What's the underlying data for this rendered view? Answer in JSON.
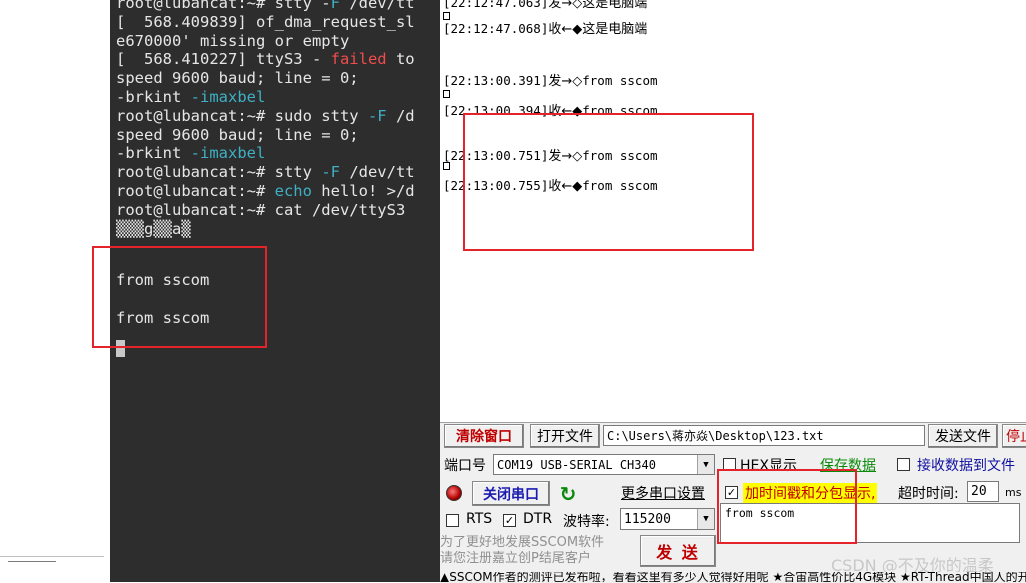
{
  "terminal": {
    "lines": [
      [
        {
          "t": "root@lubancat:~# stty -"
        },
        {
          "t": "F",
          "c": "cyan"
        },
        {
          "t": " /dev/tt"
        }
      ],
      [
        {
          "t": "[  568.409839] of_dma_request_sl"
        }
      ],
      [
        {
          "t": "e670000' missing or empty"
        }
      ],
      [
        {
          "t": "[  568.410227] ttyS3 - "
        },
        {
          "t": "failed",
          "c": "red"
        },
        {
          "t": " to"
        }
      ],
      [
        {
          "t": "speed 9600 baud; line = 0;"
        }
      ],
      [
        {
          "t": "-brkint "
        },
        {
          "t": "-imaxbel",
          "c": "cyan"
        }
      ],
      [
        {
          "t": "root@lubancat:~# sudo stty "
        },
        {
          "t": "-F",
          "c": "cyan"
        },
        {
          "t": " /d"
        }
      ],
      [
        {
          "t": "speed 9600 baud; line = 0;"
        }
      ],
      [
        {
          "t": "-brkint "
        },
        {
          "t": "-imaxbel",
          "c": "cyan"
        }
      ],
      [
        {
          "t": "root@lubancat:~# stty "
        },
        {
          "t": "-F",
          "c": "cyan"
        },
        {
          "t": " /dev/tt"
        }
      ],
      [
        {
          "t": "root@lubancat:~# "
        },
        {
          "t": "echo",
          "c": "cyan"
        },
        {
          "t": " hello! >/d"
        }
      ],
      [
        {
          "t": "root@lubancat:~# cat /dev/ttyS3"
        }
      ],
      [
        {
          "t": "▒▒▒g▒▒a▒"
        }
      ]
    ],
    "received": [
      "from sscom",
      "from sscom"
    ]
  },
  "sscom": {
    "receive_lines": [
      {
        "time": "[22:12:47.063]",
        "dir": "发→◇",
        "text": "这是电脑端"
      },
      {
        "time": "[22:12:47.068]",
        "dir": "收←◆",
        "text": "这是电脑端"
      },
      {
        "time": "[22:13:00.391]",
        "dir": "发→◇",
        "text": "from sscom"
      },
      {
        "time": "[22:13:00.394]",
        "dir": "收←◆",
        "text": "from sscom"
      },
      {
        "time": "[22:13:00.751]",
        "dir": "发→◇",
        "text": "from sscom"
      },
      {
        "time": "[22:13:00.755]",
        "dir": "收←◆",
        "text": "from sscom"
      }
    ],
    "clear_window": "清除窗口",
    "open_file": "打开文件",
    "file_path": "C:\\Users\\蒋亦焱\\Desktop\\123.txt",
    "send_file": "发送文件",
    "stop": "停止",
    "port_label": "端口号",
    "port_value": "COM19 USB-SERIAL CH340",
    "hex_display": "HEX显示",
    "save_data": "保存数据",
    "recv_to_file": "接收数据到文件",
    "close_port": "关闭串口",
    "more_settings": "更多串口设置",
    "timestamp_label": "加时间戳和分包显示,",
    "timeout_label": "超时时间:",
    "timeout_value": "20",
    "timeout_unit": "ms",
    "rts": "RTS",
    "dtr": "DTR",
    "baud_label": "波特率:",
    "baud_value": "115200",
    "send_text": "from sscom",
    "promo_line1": "为了更好地发展SSCOM软件",
    "promo_line2": "请您注册嘉立创P结尾客户",
    "send_button": "发 送",
    "status_text": "▲SSCOM作者的测评已发布啦，看看这里有多少人觉得好用呢 ★合宙高性价比4G模块 ★RT-Thread中国人的开源免费操作系统"
  },
  "watermark": "CSDN @不及你的温柔",
  "colors": {
    "terminal_bg": "#2d2d2d",
    "highlight_red": "#e3242b",
    "save_data_green": "#0a8a0a",
    "timestamp_bg": "#ffff00"
  }
}
